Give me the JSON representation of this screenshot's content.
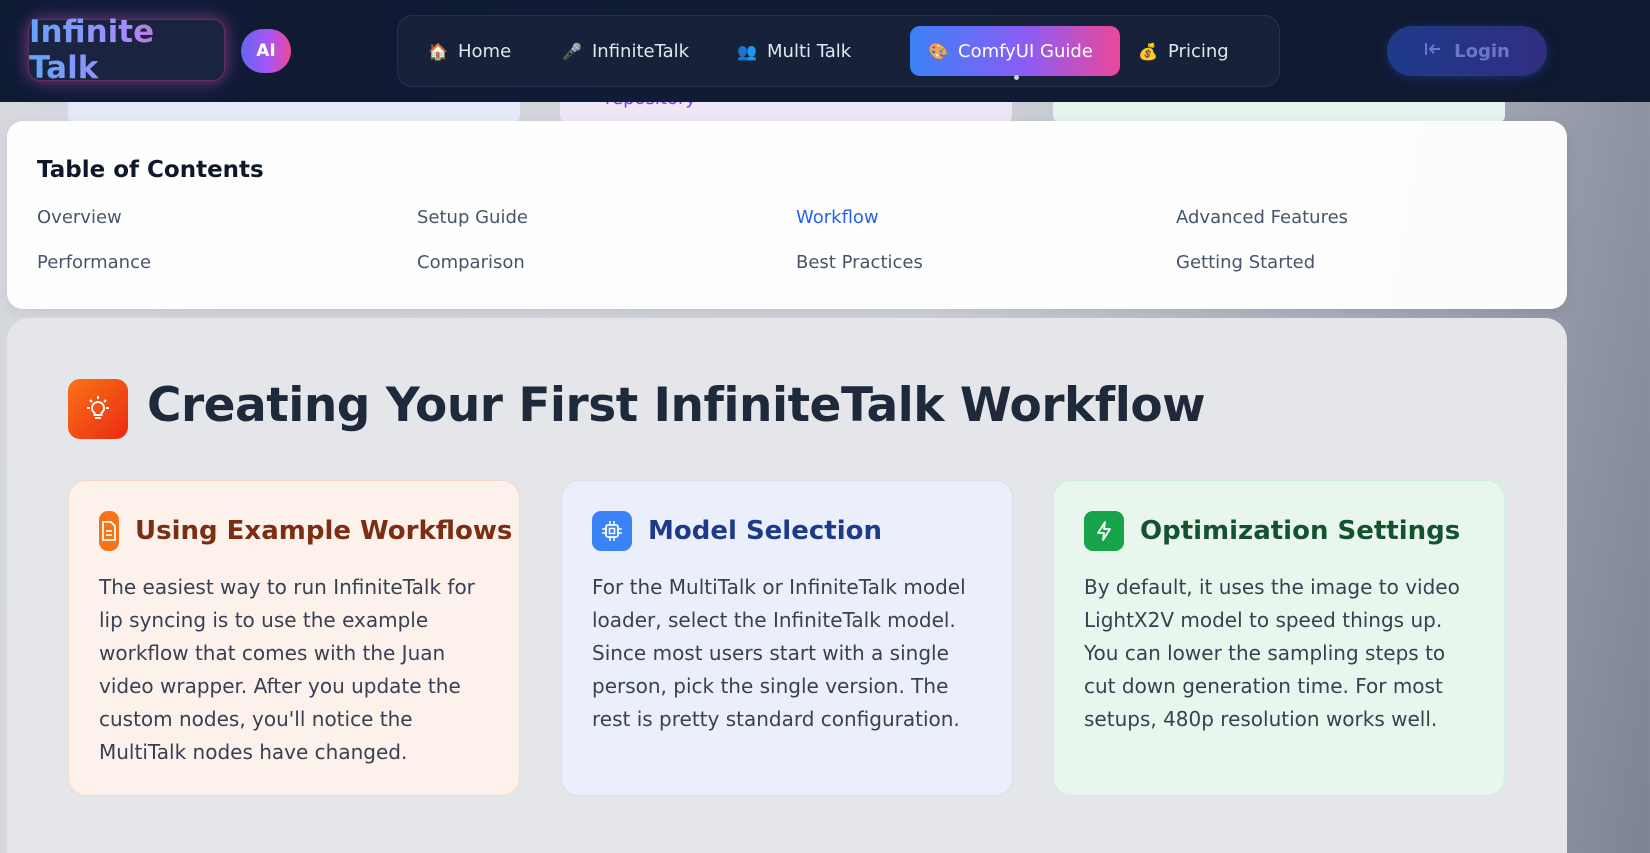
{
  "header": {
    "logo": "Infinite Talk",
    "badge": "AI",
    "nav": [
      {
        "label": "Home",
        "icon": "house-icon",
        "active": false
      },
      {
        "label": "InfiniteTalk",
        "icon": "microphone-icon",
        "active": false
      },
      {
        "label": "Multi Talk",
        "icon": "people-icon",
        "active": false
      },
      {
        "label": "ComfyUI Guide",
        "icon": "palette-icon",
        "active": true
      },
      {
        "label": "Pricing",
        "icon": "money-bag-icon",
        "active": false
      }
    ],
    "login_label": "Login"
  },
  "peek_text": "repository",
  "toc": {
    "title": "Table of Contents",
    "links": [
      "Overview",
      "Setup Guide",
      "Workflow",
      "Advanced Features",
      "Performance",
      "Comparison",
      "Best Practices",
      "Getting Started"
    ],
    "active": "Workflow"
  },
  "section": {
    "icon": "lightbulb-icon",
    "title": "Creating Your First InfiniteTalk Workflow",
    "cards": [
      {
        "icon": "document-icon",
        "title": "Using Example Workflows",
        "body": "The easiest way to run InfiniteTalk for lip syncing is to use the example workflow that comes with the Juan video wrapper. After you update the custom nodes, you'll notice the MultiTalk nodes have changed.",
        "color": "#f97316"
      },
      {
        "icon": "chip-icon",
        "title": "Model Selection",
        "body": "For the MultiTalk or InfiniteTalk model loader, select the InfiniteTalk model. Since most users start with a single person, pick the single version. The rest is pretty standard configuration.",
        "color": "#3b82f6"
      },
      {
        "icon": "lightning-icon",
        "title": "Optimization Settings",
        "body": "By default, it uses the image to video LightX2V model to speed things up. You can lower the sampling steps to cut down generation time. For most setups, 480p resolution works well.",
        "color": "#16a34a"
      }
    ]
  }
}
